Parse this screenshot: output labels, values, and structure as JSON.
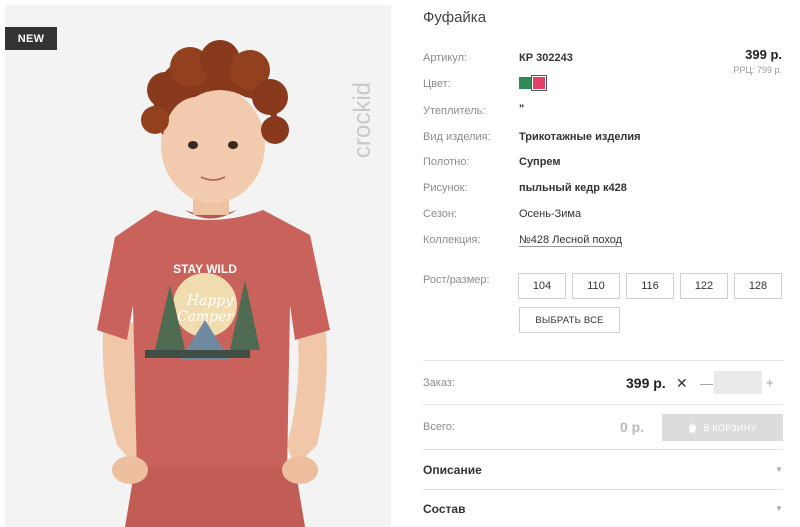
{
  "badge": "NEW",
  "brand": "crockid",
  "product": {
    "title": "Фуфайка",
    "price": "399 р.",
    "rrp": "РРЦ: 799 р.",
    "attributes": [
      {
        "label": "Артикул:",
        "value": "КР 302243"
      },
      {
        "label": "Цвет:"
      },
      {
        "label": "Утеплитель:",
        "value": "\""
      },
      {
        "label": "Вид изделия:",
        "value": "Трикотажные изделия"
      },
      {
        "label": "Полотно:",
        "value": "Супрем"
      },
      {
        "label": "Рисунок:",
        "value": "пыльный кедр к428"
      },
      {
        "label": "Сезон:",
        "value": "Осень-Зима"
      },
      {
        "label": "Коллекция:",
        "value": "№428 Лесной поход"
      }
    ],
    "colors": [
      "#2e8b57",
      "#e0406a"
    ],
    "sizes_label": "Рост/размер:",
    "sizes": [
      "104",
      "110",
      "116",
      "122",
      "128"
    ],
    "select_all": "ВЫБРАТЬ ВСЕ"
  },
  "order": {
    "label": "Заказ:",
    "price": "399 р.",
    "times": "✕",
    "minus": "—",
    "plus": "+",
    "qty": ""
  },
  "total": {
    "label": "Всего:",
    "price": "0 р.",
    "cart_button": "В КОРЗИНУ"
  },
  "accordion": [
    {
      "title": "Описание"
    },
    {
      "title": "Состав"
    }
  ],
  "tshirt_print": {
    "line1": "STAY WILD",
    "line2": "Happy",
    "line3": "Camper"
  }
}
